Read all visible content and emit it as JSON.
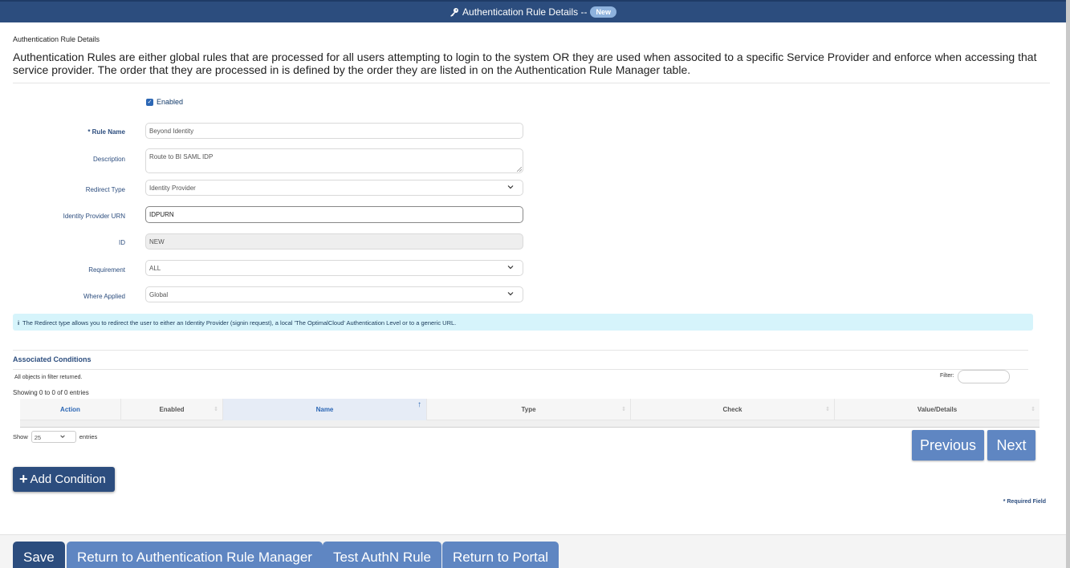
{
  "window": {
    "title": "Authentication Rule Details --",
    "badge": "New",
    "title_icon": "key-icon"
  },
  "page": {
    "section_label": "Authentication Rule Details",
    "intro": "Authentication Rules are either global rules that are processed for all users attempting to login to the system OR they are used when associted to a specific Service Provider and enforce when accessing that service provider. The order that they are processed in is defined by the order they are listed in on the Authentication Rule Manager table."
  },
  "form": {
    "enabled_label": "Enabled",
    "enabled_checked": true,
    "rule_name": {
      "label": "* Rule Name",
      "value": "Beyond Identity"
    },
    "description": {
      "label": "Description",
      "value": "Route to BI SAML IDP"
    },
    "redirect_type": {
      "label": "Redirect Type",
      "value": "Identity Provider"
    },
    "idp_urn": {
      "label": "Identity Provider URN",
      "value": "IDPURN"
    },
    "id": {
      "label": "ID",
      "value": "NEW"
    },
    "requirement": {
      "label": "Requirement",
      "value": "ALL"
    },
    "where_applied": {
      "label": "Where Applied",
      "value": "Global"
    }
  },
  "info": {
    "icon": "i",
    "text": "The Redirect type allows you to redirect the user to either an Identity Provider (signin request), a local 'The OptimalCloud' Authentication Level or to a generic URL."
  },
  "conditions": {
    "title": "Associated Conditions",
    "filter_note": "All objects in filter returned.",
    "filter_label": "Filter:",
    "filter_value": "",
    "showing": "Showing 0 to 0 of 0 entries",
    "columns": [
      "Action",
      "Enabled",
      "Name",
      "Type",
      "Check",
      "Value/Details"
    ],
    "rows": [],
    "show_label": "Show",
    "show_value": "25",
    "entries_label": "entries",
    "previous": "Previous",
    "next": "Next",
    "add_condition": "Add Condition"
  },
  "required_note": "* Required Field",
  "footer": {
    "save": "Save",
    "return_manager": "Return to Authentication Rule Manager",
    "test": "Test AuthN Rule",
    "return_portal": "Return to Portal"
  },
  "colors": {
    "primary": "#2c4d7e",
    "secondary": "#5f86c2",
    "info_bg": "#d6f4fb"
  }
}
